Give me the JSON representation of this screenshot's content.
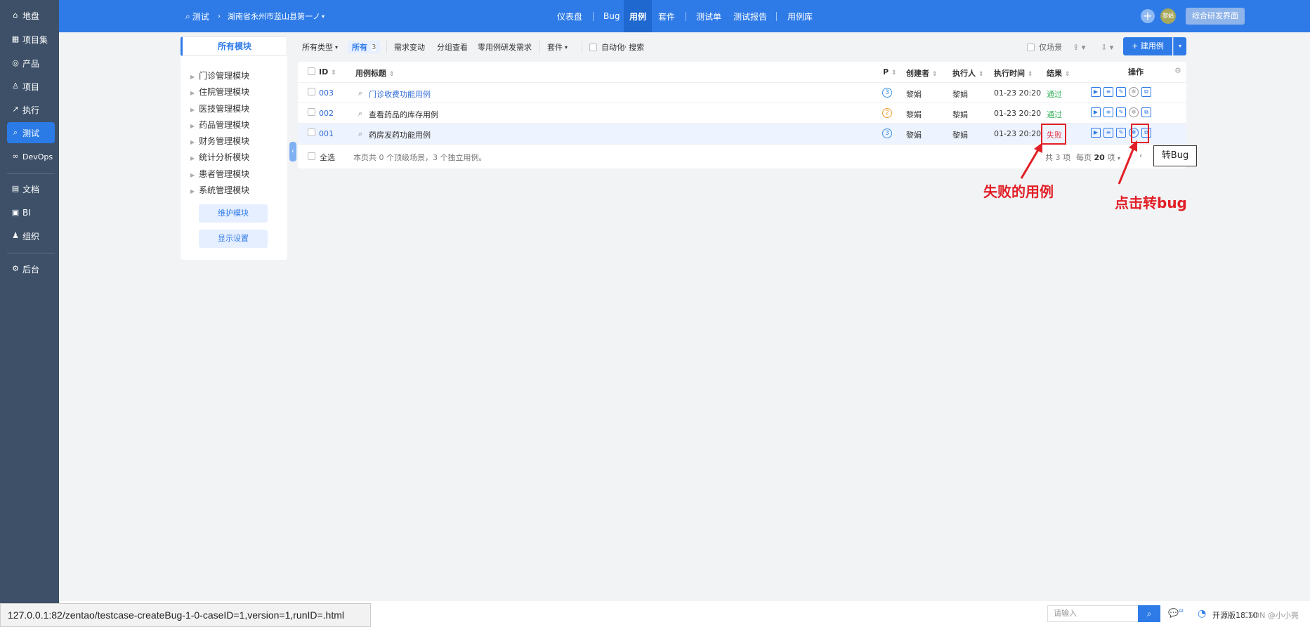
{
  "sidebar": {
    "items": [
      {
        "icon": "home-icon",
        "label": "地盘"
      },
      {
        "icon": "grid-icon",
        "label": "项目集"
      },
      {
        "icon": "lightbulb-icon",
        "label": "产品"
      },
      {
        "icon": "bell-icon",
        "label": "项目"
      },
      {
        "icon": "run-icon",
        "label": "执行"
      },
      {
        "icon": "search-icon",
        "label": "测试"
      },
      {
        "icon": "infinity-icon",
        "label": "DevOps"
      },
      {
        "icon": "doc-icon",
        "label": "文档"
      },
      {
        "icon": "chart-icon",
        "label": "BI"
      },
      {
        "icon": "org-icon",
        "label": "组织"
      },
      {
        "icon": "gear-icon",
        "label": "后台"
      }
    ]
  },
  "topbar": {
    "crumb_test": "测试",
    "crumb_project": "湖南省永州市蓝山县第一ノ",
    "nav": [
      "仪表盘",
      "Bug",
      "用例",
      "套件",
      "测试单",
      "测试报告",
      "用例库"
    ],
    "avatar": "黎娟",
    "switch_label": "综合研发界面"
  },
  "modules": {
    "header": "所有模块",
    "items": [
      "门诊管理模块",
      "住院管理模块",
      "医技管理模块",
      "药品管理模块",
      "财务管理模块",
      "统计分析模块",
      "患者管理模块",
      "系统管理模块"
    ],
    "btn_maintain": "维护模块",
    "btn_display": "显示设置"
  },
  "filters": {
    "all_types": "所有类型",
    "all": "所有",
    "all_count": "3",
    "req_change": "需求变动",
    "group_view": "分组查看",
    "zero_case": "零用例研发需求",
    "suite": "套件",
    "automation": "自动化",
    "search": "搜索",
    "scene_only": "仅场景",
    "new_case": "+ 建用例"
  },
  "table": {
    "headers": {
      "id": "ID",
      "title": "用例标题",
      "p": "P",
      "creator": "创建者",
      "executor": "执行人",
      "exec_time": "执行时间",
      "result": "结果",
      "ops": "操作"
    },
    "rows": [
      {
        "id": "003",
        "title": "门诊收费功能用例",
        "p": "3",
        "creator": "黎娟",
        "executor": "黎娟",
        "time": "01-23 20:20",
        "result": "通过"
      },
      {
        "id": "002",
        "title": "查看药品的库存用例",
        "p": "2",
        "creator": "黎娟",
        "executor": "黎娟",
        "time": "01-23 20:20",
        "result": "通过"
      },
      {
        "id": "001",
        "title": "药房发药功能用例",
        "p": "3",
        "creator": "黎娟",
        "executor": "黎娟",
        "time": "01-23 20:20",
        "result": "失败"
      }
    ],
    "select_all": "全选",
    "summary": "本页共 0 个顶级场景，3 个独立用例。",
    "total": "共 3 项",
    "per_page_label": "每页",
    "per_page": "20",
    "per_page_unit": "项"
  },
  "annotations": {
    "failed_case": "失败的用例",
    "click_to_bug": "点击转bug",
    "tooltip": "转Bug"
  },
  "status_url": "127.0.0.1:82/zentao/testcase-createBug-1-0-caseID=1,version=1,runID=.html",
  "footer": {
    "search_placeholder": "请输入",
    "ai": "AI",
    "edition": "开源版18.10",
    "watermark": "CSDN @小小亮"
  }
}
